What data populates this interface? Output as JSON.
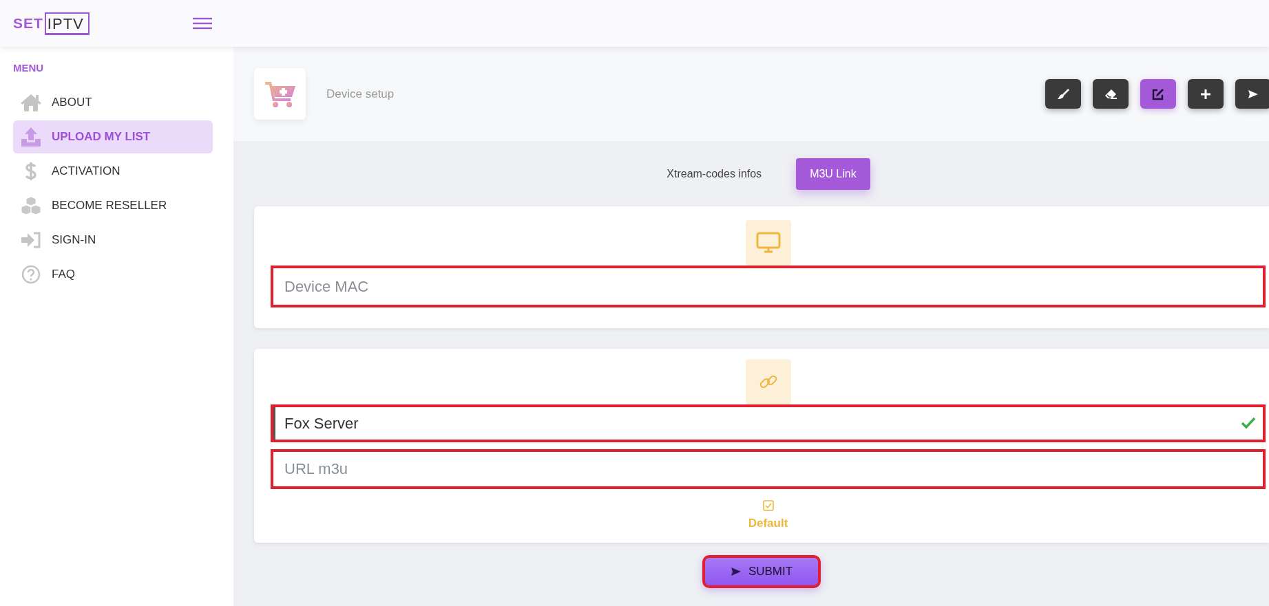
{
  "logo": {
    "brand": "SET",
    "boxed": "IPTV"
  },
  "sidebar": {
    "heading": "MENU",
    "items": [
      {
        "label": "ABOUT",
        "kind": "home",
        "selected": false
      },
      {
        "label": "UPLOAD MY LIST",
        "kind": "upload",
        "selected": true
      },
      {
        "label": "ACTIVATION",
        "kind": "dollar",
        "selected": false
      },
      {
        "label": "BECOME RESELLER",
        "kind": "cubes",
        "selected": false
      },
      {
        "label": "SIGN-IN",
        "kind": "signin",
        "selected": false
      },
      {
        "label": "FAQ",
        "kind": "question",
        "selected": false
      }
    ]
  },
  "page_header": {
    "title": "Device setup"
  },
  "toolbar": {
    "buttons": [
      {
        "kind": "brush",
        "selected": false
      },
      {
        "kind": "eraser",
        "selected": false
      },
      {
        "kind": "edit",
        "selected": true
      },
      {
        "kind": "plus",
        "selected": false
      },
      {
        "kind": "send",
        "selected": false
      }
    ]
  },
  "tabs": [
    {
      "label": "Xtream-codes infos",
      "selected": false
    },
    {
      "label": "M3U Link",
      "selected": true
    }
  ],
  "device_card": {
    "field": {
      "placeholder": "Device MAC",
      "highlighted": true
    }
  },
  "playlist_card": {
    "name_field": {
      "value": "Fox Server",
      "valid": true,
      "highlighted": true
    },
    "url_field": {
      "placeholder": "URL m3u",
      "highlighted": true
    },
    "default_option": {
      "label": "Default",
      "checked": true
    }
  },
  "submit": {
    "label": "SUBMIT",
    "highlighted": true
  }
}
